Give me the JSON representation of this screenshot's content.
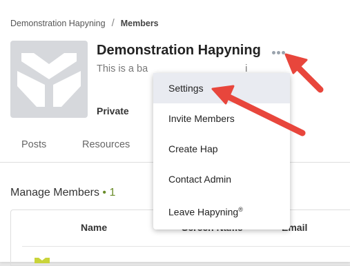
{
  "breadcrumb": {
    "parent": "Demonstration Hapyning",
    "separator": "/",
    "current": "Members"
  },
  "group": {
    "title": "Demonstration Hapyning",
    "description_visible": "This is a ba",
    "description_tail": "i",
    "privacy": "Private"
  },
  "tabs": [
    {
      "label": "Posts"
    },
    {
      "label": "Resources"
    }
  ],
  "manage": {
    "label": "Manage Members",
    "bullet": "•",
    "count": "1"
  },
  "table": {
    "columns": [
      "Name",
      "Screen Name",
      "Email"
    ]
  },
  "menu": {
    "items": [
      {
        "label": "Settings"
      },
      {
        "label": "Invite Members"
      },
      {
        "label": "Create Hap"
      },
      {
        "label": "Contact Admin"
      },
      {
        "label": "Leave Hapyning",
        "mark": "®"
      }
    ]
  },
  "icons": {
    "more": "more-horizontal-icon",
    "annotation": "red-arrow-annotation"
  },
  "colors": {
    "arrow": "#e8463c",
    "logo_bg": "#d6d8dc",
    "count": "#6a8c2a"
  }
}
